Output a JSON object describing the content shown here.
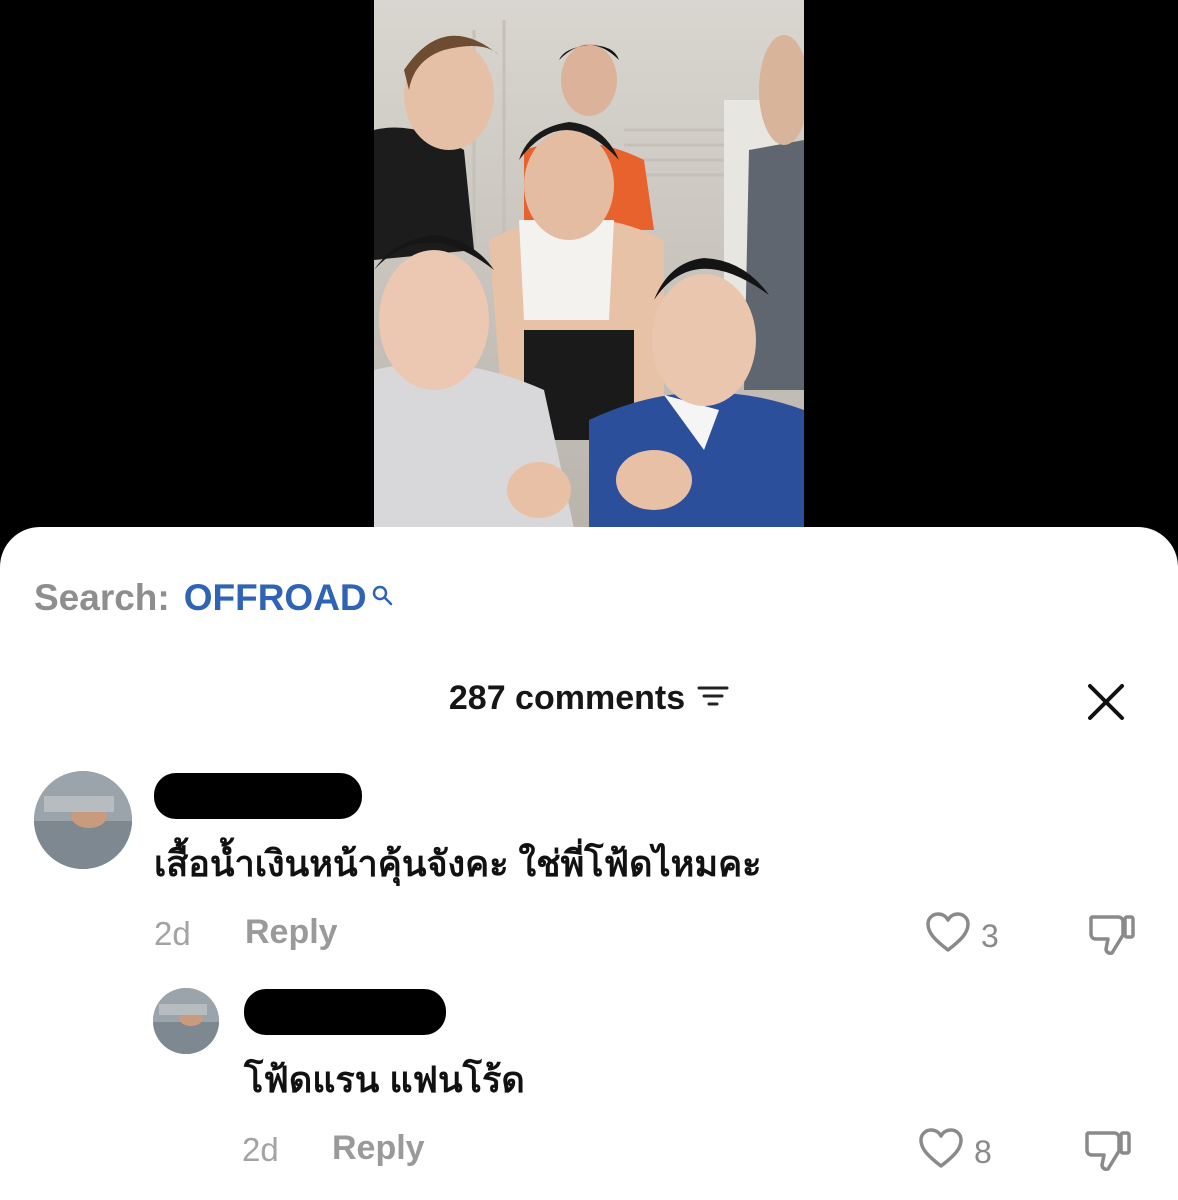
{
  "search": {
    "prefix": "Search:",
    "term": "OFFROAD"
  },
  "comments_header": {
    "count_label": "287 comments"
  },
  "comments": [
    {
      "text": "เสื้อน้ำเงินหน้าคุ้นจังคะ ใช่พี่โฟ้ดไหมคะ",
      "age": "2d",
      "reply_label": "Reply",
      "likes": "3"
    },
    {
      "text": "โฟ้ดแรน แฟนโร้ด",
      "age": "2d",
      "reply_label": "Reply",
      "likes": "8"
    }
  ],
  "icons": {
    "search": "magnifier-icon",
    "filter": "filter-icon",
    "close": "close-icon",
    "like": "heart-icon",
    "dislike": "thumbs-down-icon"
  },
  "colors": {
    "search_term": "#2f63b5",
    "sheet_bg": "#ffffff",
    "backdrop": "#000000"
  }
}
